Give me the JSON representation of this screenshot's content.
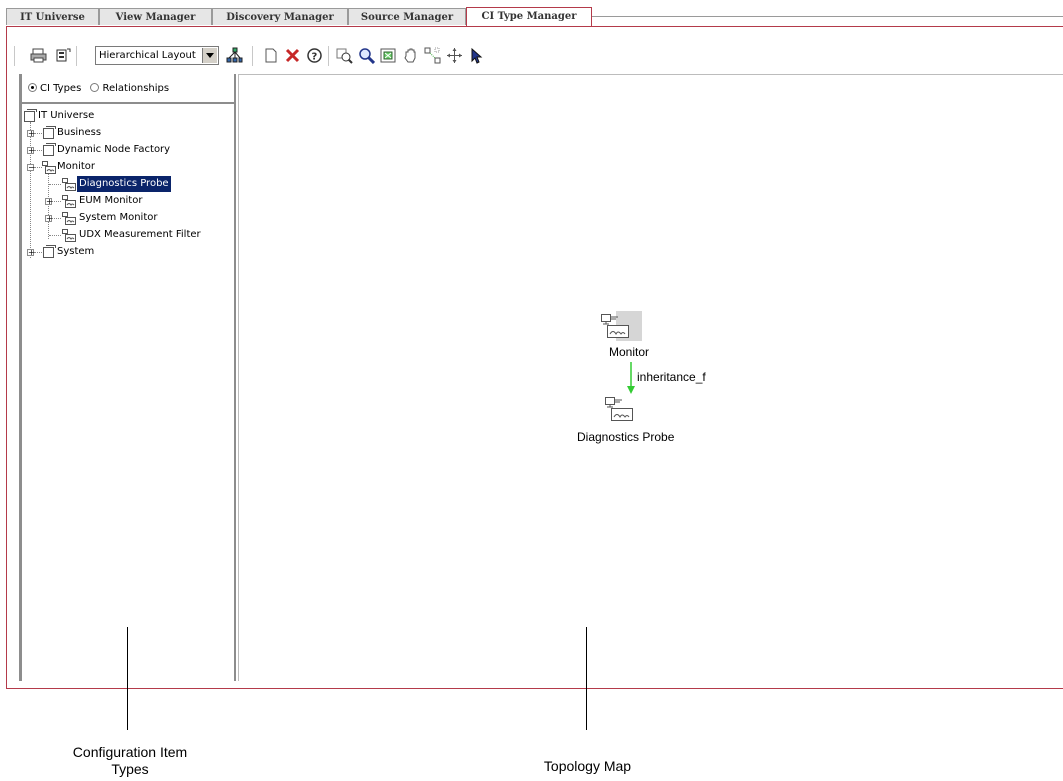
{
  "tabs": [
    {
      "label": "IT Universe"
    },
    {
      "label": "View Manager"
    },
    {
      "label": "Discovery Manager"
    },
    {
      "label": "Source Manager"
    },
    {
      "label": "CI Type Manager"
    }
  ],
  "toolbar": {
    "layout_select_value": "Hierarchical Layout",
    "icons": [
      "print-icon",
      "export-icon",
      "layout-icon",
      "new-icon",
      "delete-icon",
      "help-icon",
      "zoom-in-icon",
      "zoom-out-icon",
      "fit-icon",
      "pan-icon",
      "fit-selection-icon",
      "move-icon",
      "pointer-icon"
    ]
  },
  "left_panel": {
    "radio_ci_types": "CI Types",
    "radio_relationships": "Relationships",
    "selected_radio": "CI Types",
    "tree": [
      {
        "label": "IT Universe"
      },
      {
        "label": "Business"
      },
      {
        "label": "Dynamic Node Factory"
      },
      {
        "label": "Monitor"
      },
      {
        "label": "Diagnostics Probe"
      },
      {
        "label": "EUM Monitor"
      },
      {
        "label": "System Monitor"
      },
      {
        "label": "UDX Measurement Filter"
      },
      {
        "label": "System"
      }
    ],
    "selected_item": "Diagnostics Probe"
  },
  "map": {
    "nodes": [
      {
        "label": "Monitor"
      },
      {
        "label": "Diagnostics Probe"
      }
    ],
    "edge_label": "inheritance_f",
    "edge_color": "#33cc33"
  },
  "callouts": {
    "left": "Configuration Item Types",
    "right": "Topology Map"
  },
  "colors": {
    "frame_border": "#b43a4a",
    "selection": "#0a246a"
  }
}
